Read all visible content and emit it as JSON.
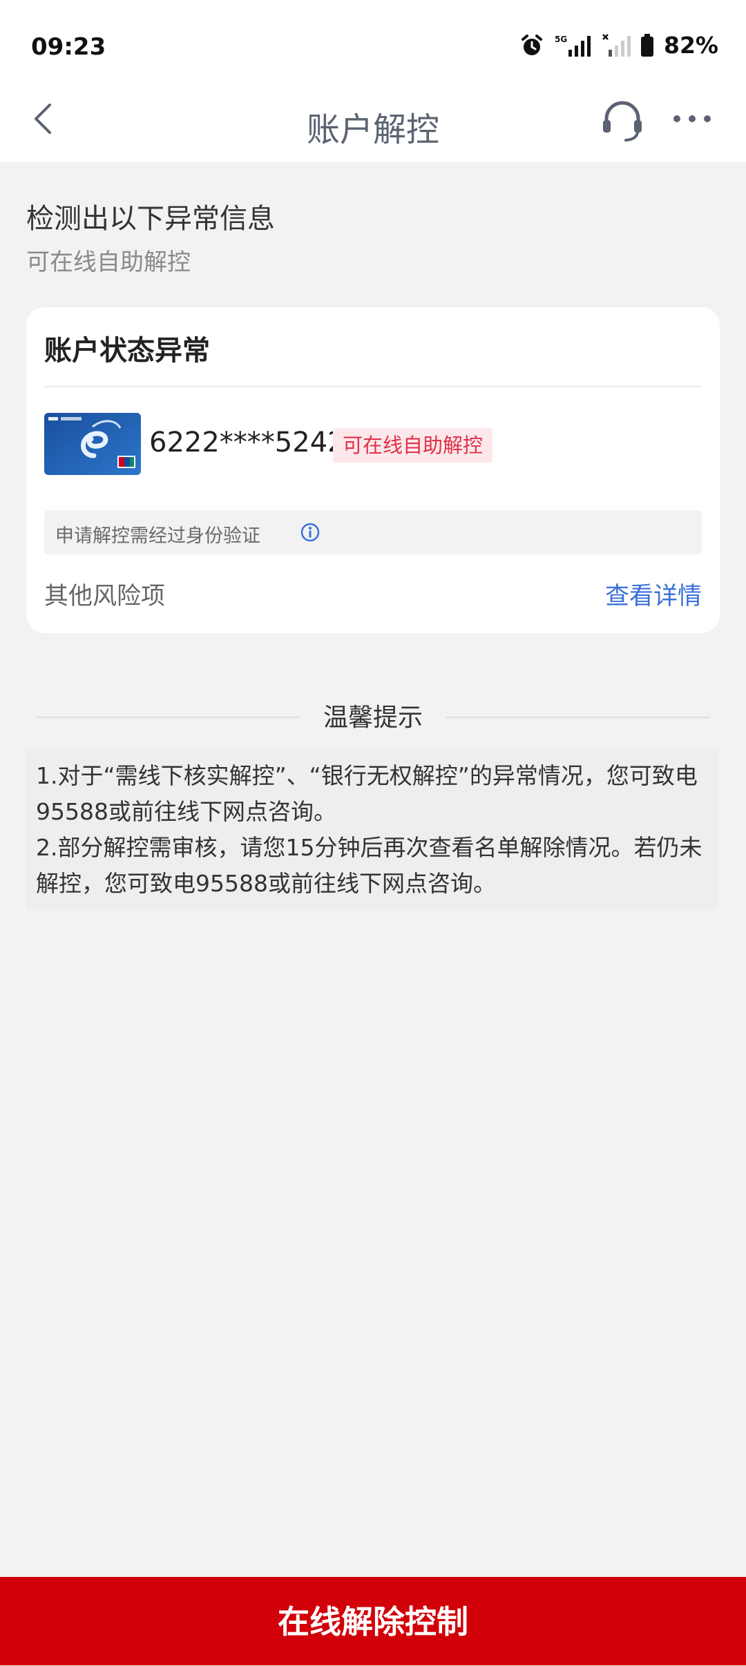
{
  "status_bar": {
    "time": "09:23",
    "battery": "82%",
    "network": "5G"
  },
  "nav": {
    "title": "账户解控"
  },
  "detect": {
    "title": "检测出以下异常信息",
    "subtitle": "可在线自助解控"
  },
  "card": {
    "title": "账户状态异常",
    "card_number": "6222****5242",
    "badge": "可在线自助解控",
    "verify_note": "申请解控需经过身份验证",
    "other_risk_label": "其他风险项",
    "view_details_label": "查看详情"
  },
  "tips": {
    "title": "温馨提示",
    "items": [
      "1.对于“需线下核实解控”、“银行无权解控”的异常情况，您可致电95588或前往线下网点咨询。",
      "2.部分解控需审核，请您15分钟后再次查看名单解除情况。若仍未解控，您可致电95588或前往线下网点咨询。"
    ]
  },
  "bottom_button": {
    "label": "在线解除控制"
  },
  "colors": {
    "primary_red": "#d10009",
    "link_blue": "#3a6fd8",
    "badge_red": "#e0304a",
    "badge_bg": "#fce8ea"
  }
}
